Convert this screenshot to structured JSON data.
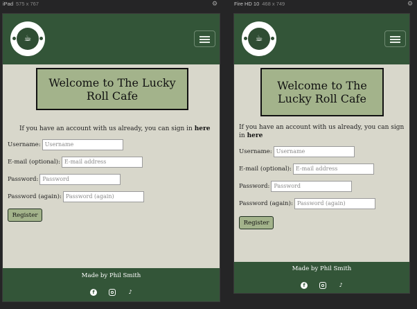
{
  "devices": [
    {
      "name": "iPad",
      "size": "575 x 767",
      "site": {
        "welcome": "Welcome to The Lucky Roll Cafe",
        "signin_text": "If you have an account with us already, you can sign in",
        "signin_link": "here",
        "fields": [
          {
            "label": "Username:",
            "placeholder": "Username"
          },
          {
            "label": "E-mail (optional):",
            "placeholder": "E-mail address"
          },
          {
            "label": "Password:",
            "placeholder": "Password"
          },
          {
            "label": "Password (again):",
            "placeholder": "Password (again)"
          }
        ],
        "register": "Register",
        "footer": "Made by Phil Smith"
      }
    },
    {
      "name": "Fire HD 10",
      "size": "468 x 749",
      "site": {
        "welcome": "Welcome to The Lucky Roll Cafe",
        "signin_text": "If you have an account with us already, you can sign in",
        "signin_link": "here",
        "fields": [
          {
            "label": "Username:",
            "placeholder": "Username"
          },
          {
            "label": "E-mail (optional):",
            "placeholder": "E-mail address"
          },
          {
            "label": "Password:",
            "placeholder": "Password"
          },
          {
            "label": "Password (again):",
            "placeholder": "Password (again)"
          }
        ],
        "register": "Register",
        "footer": "Made by Phil Smith"
      }
    }
  ],
  "icons": [
    "settings-gear-icon",
    "coffee-cup-logo",
    "hamburger-menu-icon",
    "facebook-icon",
    "instagram-icon",
    "tiktok-icon"
  ],
  "colors": {
    "navbar": "#335538",
    "page_bg": "#d8d7cb",
    "welcome_bg": "#a3b38b",
    "devtools_bg": "#252526"
  }
}
